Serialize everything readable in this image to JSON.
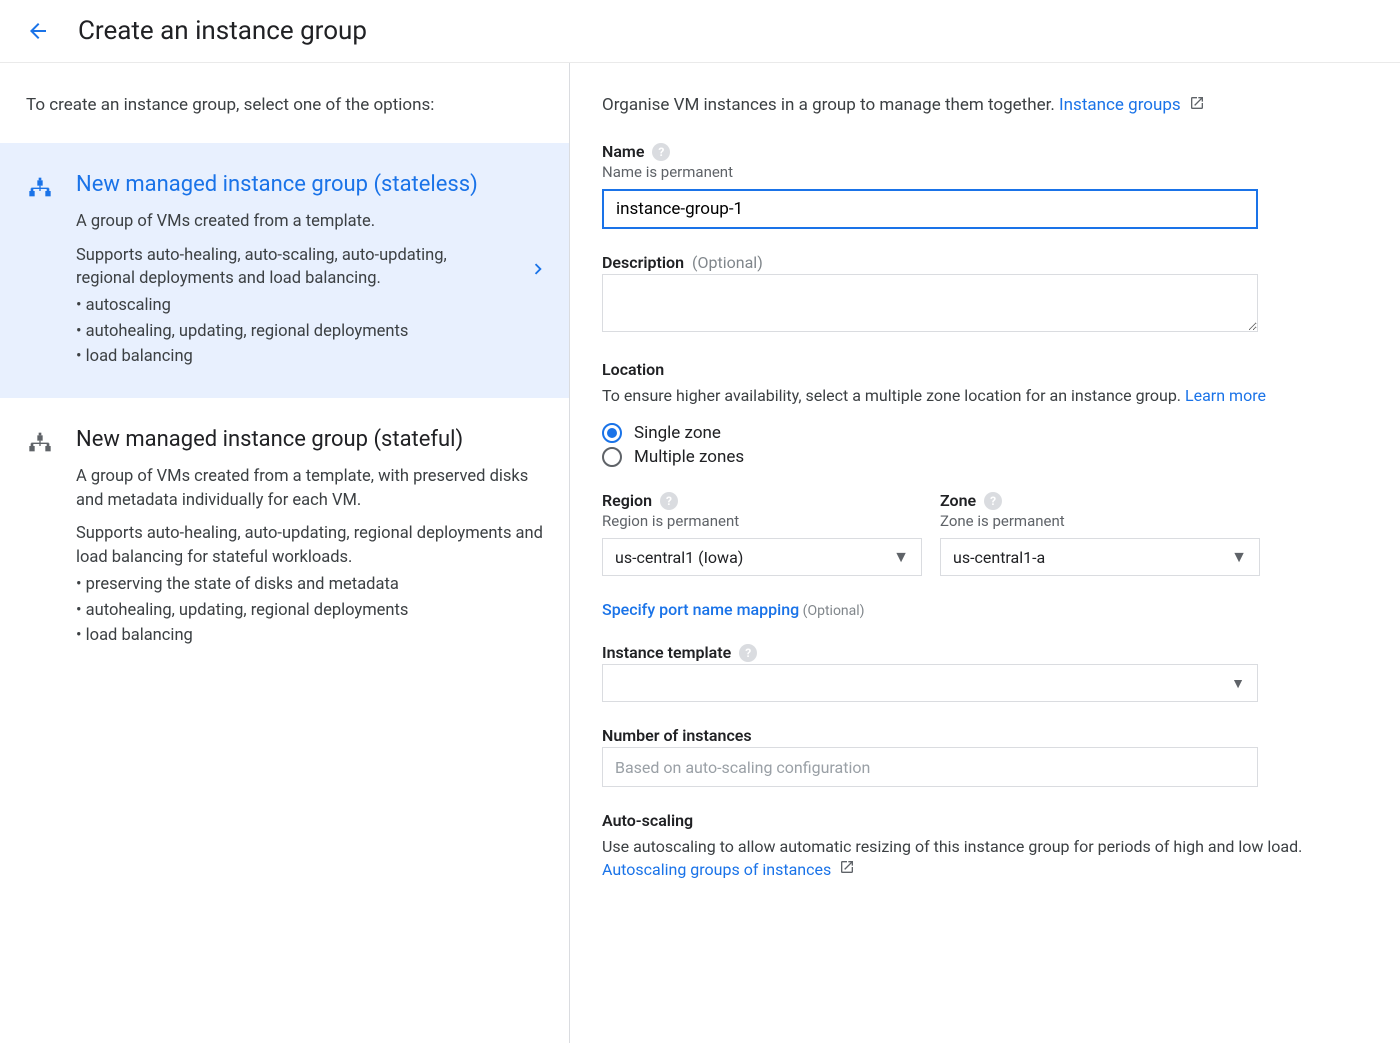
{
  "header": {
    "title": "Create an instance group"
  },
  "left": {
    "intro": "To create an instance group, select one of the options:",
    "option1": {
      "title": "New managed instance group (stateless)",
      "desc": "A group of VMs created from a template.",
      "supports": "Supports auto-healing, auto-scaling, auto-updating, regional deployments and load balancing.",
      "b1": "• autoscaling",
      "b2": "• autohealing, updating, regional deployments",
      "b3": "• load balancing"
    },
    "option2": {
      "title": "New managed instance group (stateful)",
      "desc": "A group of VMs created from a template, with preserved disks and metadata individually for each VM.",
      "supports": "Supports auto-healing, auto-updating, regional deployments and load balancing for stateful workloads.",
      "b1": "• preserving the state of disks and metadata",
      "b2": "• autohealing, updating, regional deployments",
      "b3": "• load balancing"
    }
  },
  "right": {
    "organise": "Organise VM instances in a group to manage them together. ",
    "organise_link": "Instance groups",
    "name": {
      "label": "Name",
      "hint": "Name is permanent",
      "value": "instance-group-1"
    },
    "description": {
      "label": "Description",
      "optional": "(Optional)"
    },
    "location": {
      "label": "Location",
      "desc": "To ensure higher availability, select a multiple zone location for an instance group.",
      "learn": "Learn more",
      "opt1": "Single zone",
      "opt2": "Multiple zones"
    },
    "region": {
      "label": "Region",
      "hint": "Region is permanent",
      "value": "us-central1 (Iowa)"
    },
    "zone": {
      "label": "Zone",
      "hint": "Zone is permanent",
      "value": "us-central1-a"
    },
    "port": {
      "link": "Specify port name mapping",
      "optional": "(Optional)"
    },
    "template": {
      "label": "Instance template"
    },
    "num": {
      "label": "Number of instances",
      "placeholder": "Based on auto-scaling configuration"
    },
    "autoscale": {
      "label": "Auto-scaling",
      "desc_a": "Use autoscaling to allow automatic resizing of this instance group for periods of high and low load. ",
      "link": "Autoscaling groups of instances"
    }
  }
}
